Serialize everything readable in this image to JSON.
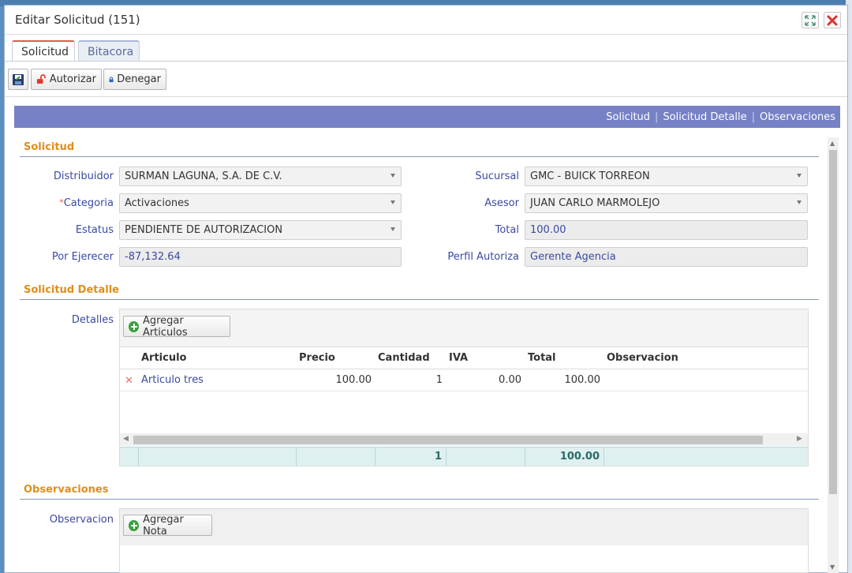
{
  "window": {
    "title": "Editar Solicitud (151)"
  },
  "tabs": [
    {
      "label": "Solicitud"
    },
    {
      "label": "Bitacora"
    }
  ],
  "toolbar": {
    "authorize_label": "Autorizar",
    "deny_label": "Denegar"
  },
  "nav": {
    "links": [
      "Solicitud",
      "Solicitud Detalle",
      "Observaciones"
    ],
    "separator": "|"
  },
  "sections": {
    "solicitud": "Solicitud",
    "detalle": "Solicitud Detalle",
    "observaciones": "Observaciones"
  },
  "form": {
    "distribuidor": {
      "label": "Distribuidor",
      "value": "SURMAN LAGUNA, S.A. DE C.V."
    },
    "categoria": {
      "label": "Categoria",
      "required_mark": "*",
      "value": "Activaciones"
    },
    "estatus": {
      "label": "Estatus",
      "value": "PENDIENTE DE AUTORIZACION"
    },
    "por_ejercer": {
      "label": "Por Ejerecer",
      "value": "-87,132.64"
    },
    "sucursal": {
      "label": "Sucursal",
      "value": "GMC - BUICK TORREON"
    },
    "asesor": {
      "label": "Asesor",
      "value": "JUAN CARLO MARMOLEJO"
    },
    "total": {
      "label": "Total",
      "value": "100.00"
    },
    "perfil_autoriza": {
      "label": "Perfil Autoriza",
      "value": "Gerente Agencia"
    }
  },
  "detalle": {
    "label": "Detalles",
    "add_button": "Agregar Articulos",
    "columns": [
      "Articulo",
      "Precio",
      "Cantidad",
      "IVA",
      "Total",
      "Observacion"
    ],
    "rows": [
      {
        "articulo": "Articulo tres",
        "precio": "100.00",
        "cantidad": "1",
        "iva": "0.00",
        "total": "100.00",
        "observacion": ""
      }
    ],
    "footer": {
      "cantidad": "1",
      "total": "100.00"
    }
  },
  "observaciones": {
    "label": "Observacion",
    "add_button": "Agregar Nota"
  },
  "colors": {
    "accent_nav": "#7682c5",
    "section_title": "#e08e1a",
    "label": "#3a4aa0"
  }
}
